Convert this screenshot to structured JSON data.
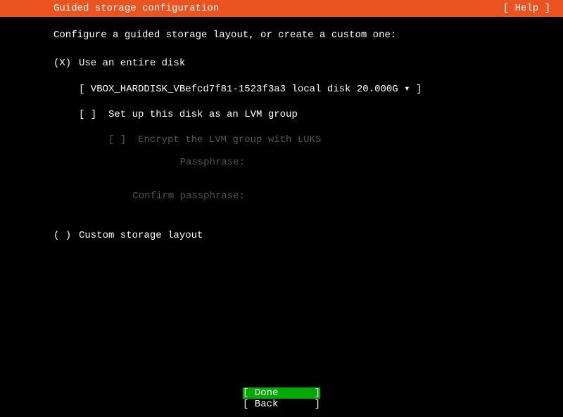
{
  "header": {
    "title": "Guided storage configuration",
    "help": "[ Help ]"
  },
  "instruction": "Configure a guided storage layout, or create a custom one:",
  "options": {
    "entire_disk": {
      "mark": "(X)",
      "label": "Use an entire disk"
    },
    "disk_selector": "[ VBOX_HARDDISK_VBefcd7f81-1523f3a3 local disk 20.000G ▾ ]",
    "lvm": {
      "mark": "[ ]",
      "label": "Set up this disk as an LVM group"
    },
    "encrypt": {
      "mark": "[ ]",
      "label": "Encrypt the LVM group with LUKS"
    },
    "passphrase_label": "Passphrase:",
    "confirm_label": "Confirm passphrase:",
    "custom": {
      "mark": "( )",
      "label": "Custom storage layout"
    }
  },
  "footer": {
    "done": "[ Done",
    "done_r": "]",
    "back": "[ Back",
    "back_r": "]"
  }
}
